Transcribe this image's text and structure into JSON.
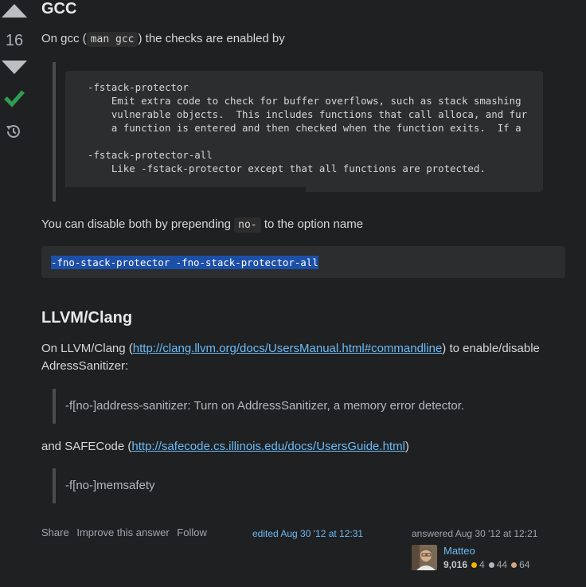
{
  "vote": {
    "count": "16"
  },
  "section_gcc": {
    "heading": "GCC",
    "intro_before": "On gcc (",
    "intro_code": "man gcc",
    "intro_after": ") the checks are enabled by",
    "man_excerpt": "-fstack-protector\n    Emit extra code to check for buffer overflows, such as stack smashing\n    vulnerable objects.  This includes functions that call alloca, and fur\n    a function is entered and then checked when the function exits.  If a\n\n-fstack-protector-all\n    Like -fstack-protector except that all functions are protected.",
    "disable_before": "You can disable both by prepending",
    "disable_code": "no-",
    "disable_after": "to the option name",
    "disable_cmd": "-fno-stack-protector -fno-stack-protector-all"
  },
  "section_llvm": {
    "heading": "LLVM/Clang",
    "intro_before": "On LLVM/Clang (",
    "intro_link": "http://clang.llvm.org/docs/UsersManual.html#commandline",
    "intro_after": ") to enable/disable AdressSanitizer:",
    "quote1": "-f[no-]address-sanitizer: Turn on AddressSanitizer, a memory error detector.",
    "safe_before": "and SAFECode (",
    "safe_link": "http://safecode.cs.illinois.edu/docs/UsersGuide.html",
    "safe_after": ")",
    "quote2": "-f[no-]memsafety"
  },
  "footer": {
    "share": "Share",
    "improve": "Improve this answer",
    "follow": "Follow",
    "edited": "edited Aug 30 '12 at 12:31",
    "answered": "answered Aug 30 '12 at 12:21",
    "user": {
      "name": "Matteo",
      "reputation": "9,016",
      "gold": "4",
      "silver": "44",
      "bronze": "64"
    }
  },
  "colors": {
    "gold": "#f1b600",
    "silver": "#b4b8bc",
    "bronze": "#d1a684",
    "accepted": "#2f9e54",
    "link": "#6cbbf7"
  }
}
